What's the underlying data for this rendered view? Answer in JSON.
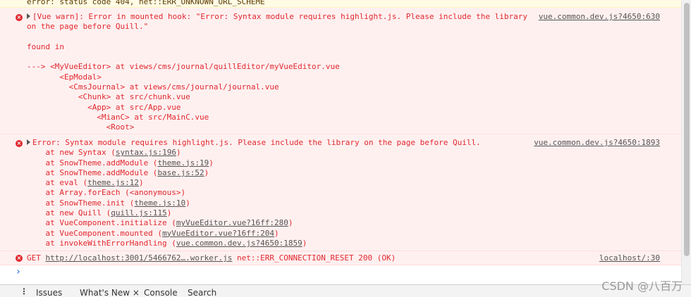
{
  "top_warning": "error: status code 404, net::ERR_UNKNOWN_URL_SCHEME",
  "vue_warn": {
    "line1": "[Vue warn]: Error in mounted hook: \"Error: Syntax module requires highlight.js. Please include the library",
    "line2": "on the page before Quill.\"",
    "found_in": "found in",
    "trace": [
      "---> <MyVueEditor> at views/cms/journal/quillEditor/myVueEditor.vue",
      "       <EpModal>",
      "         <CmsJournal> at views/cms/journal/journal.vue",
      "           <Chunk> at src/chunk.vue",
      "             <App> at src/App.vue",
      "               <MianC> at src/MainC.vue",
      "                 <Root>"
    ],
    "source": "vue.common.dev.js?4650:630"
  },
  "syntax_error": {
    "headline": "Error: Syntax module requires highlight.js. Please include the library on the page before Quill.",
    "source": "vue.common.dev.js?4650:1893",
    "stack": [
      {
        "prefix": "    at new Syntax (",
        "link": "syntax.js:196",
        "suffix": ")"
      },
      {
        "prefix": "    at SnowTheme.addModule (",
        "link": "theme.js:19",
        "suffix": ")"
      },
      {
        "prefix": "    at SnowTheme.addModule (",
        "link": "base.js:52",
        "suffix": ")"
      },
      {
        "prefix": "    at eval (",
        "link": "theme.js:12",
        "suffix": ")"
      },
      {
        "prefix": "    at Array.forEach (<anonymous>)",
        "link": "",
        "suffix": ""
      },
      {
        "prefix": "    at SnowTheme.init (",
        "link": "theme.js:10",
        "suffix": ")"
      },
      {
        "prefix": "    at new Quill (",
        "link": "quill.js:115",
        "suffix": ")"
      },
      {
        "prefix": "    at VueComponent.initialize (",
        "link": "myVueEditor.vue?16ff:280",
        "suffix": ")"
      },
      {
        "prefix": "    at VueComponent.mounted (",
        "link": "myVueEditor.vue?16ff:204",
        "suffix": ")"
      },
      {
        "prefix": "    at invokeWithErrorHandling (",
        "link": "vue.common.dev.js?4650:1859",
        "suffix": ")"
      }
    ]
  },
  "get_error": {
    "method": "GET",
    "url": "http://localhost:3001/5466762….worker.js",
    "status": "net::ERR_CONNECTION_RESET 200 (OK)",
    "source": "localhost/:30"
  },
  "prompt_symbol": "›",
  "drawer": {
    "menu_icon": "more-vertical-icon",
    "tabs": [
      "Issues",
      "What's New",
      "Console",
      "Search"
    ],
    "close_symbol": "×"
  },
  "watermark": "CSDN @八百万"
}
